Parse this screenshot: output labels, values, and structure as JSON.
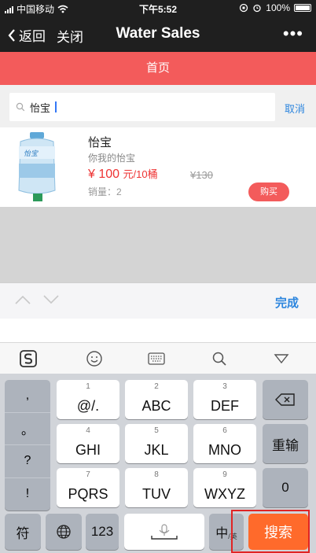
{
  "status_bar": {
    "carrier": "中国移动",
    "time": "下午5:52",
    "battery": "100%"
  },
  "nav": {
    "back_label": "返回",
    "close_label": "关闭",
    "title": "Water Sales",
    "more": "•••"
  },
  "tab": {
    "label": "首页"
  },
  "search": {
    "value": "怡宝",
    "cancel_label": "取消"
  },
  "product": {
    "name": "怡宝",
    "desc": "你我的怡宝",
    "currency": "¥",
    "price": "100",
    "unit": "元/10桶",
    "old_price": "¥130",
    "sales_label": "销量：2",
    "buy_label": "购买"
  },
  "accessory": {
    "done_label": "完成"
  },
  "keyboard": {
    "punct": [
      ",",
      "。",
      "?",
      "!"
    ],
    "keys": [
      {
        "num": "1",
        "label": "@/."
      },
      {
        "num": "2",
        "label": "ABC"
      },
      {
        "num": "3",
        "label": "DEF"
      },
      {
        "num": "4",
        "label": "GHI"
      },
      {
        "num": "5",
        "label": "JKL"
      },
      {
        "num": "6",
        "label": "MNO"
      },
      {
        "num": "7",
        "label": "PQRS"
      },
      {
        "num": "8",
        "label": "TUV"
      },
      {
        "num": "9",
        "label": "WXYZ"
      }
    ],
    "reinput_label": "重输",
    "zero_label": "0",
    "symbol_label": "符",
    "num_label": "123",
    "lang_label_main": "中",
    "lang_label_sub": "/英",
    "search_label": "搜索"
  },
  "colors": {
    "accent_red": "#f35b5b",
    "search_orange": "#ff6a2b",
    "link_blue": "#2e86de"
  }
}
